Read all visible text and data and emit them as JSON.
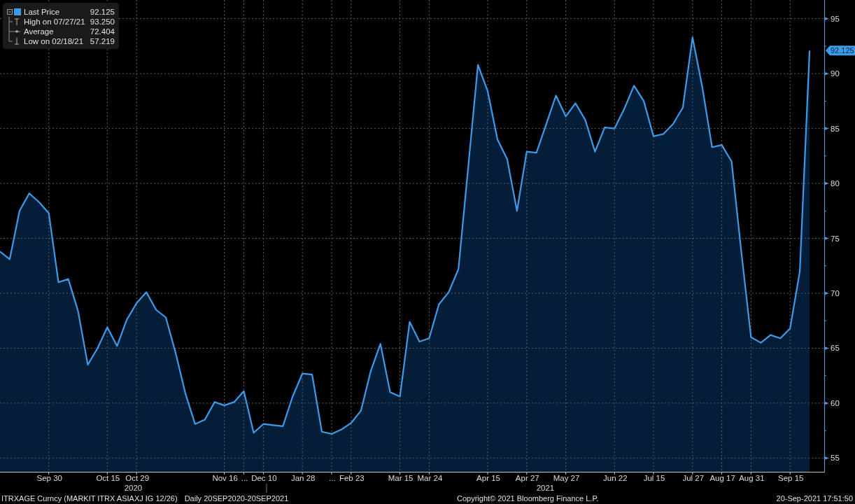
{
  "legend": {
    "expanded": true,
    "items": [
      {
        "kind": "series",
        "value": "92.125"
      },
      {
        "kind": "high",
        "label": "High on 07/27/21",
        "value": "93.250"
      },
      {
        "kind": "average",
        "label": "Average",
        "value": "72.404"
      },
      {
        "kind": "low",
        "label": "Low on 02/18/21",
        "value": "57.219"
      }
    ]
  },
  "chart": {
    "price_tag": "92.125",
    "chart_data": {
      "type": "area",
      "grid": true,
      "categories": [
        null,
        null,
        null,
        null,
        null,
        "Sep 30",
        null,
        null,
        null,
        null,
        null,
        "Oct 15",
        null,
        null,
        "Oct 29",
        null,
        null,
        null,
        null,
        null,
        null,
        null,
        null,
        "Nov 16",
        null,
        "...",
        null,
        "Dec 10",
        null,
        null,
        null,
        "Jan 28",
        null,
        null,
        "...",
        null,
        "Feb 23",
        null,
        null,
        null,
        null,
        "Mar 15",
        null,
        null,
        "Mar 24",
        null,
        null,
        null,
        null,
        null,
        "Apr 15",
        null,
        null,
        null,
        "Apr 27",
        null,
        null,
        null,
        "May 27",
        null,
        null,
        null,
        null,
        "Jun 22",
        null,
        null,
        null,
        "Jul 15",
        null,
        null,
        null,
        "Jul 27",
        null,
        null,
        "Aug 17",
        null,
        null,
        "Aug 31",
        null,
        null,
        null,
        "Sep 15",
        null,
        null
      ],
      "series": [
        {
          "name": "Last Price",
          "color": "#3d9be9",
          "values": [
            73.8,
            73.1,
            77.5,
            79.1,
            78.3,
            77.3,
            71.0,
            71.3,
            68.4,
            63.5,
            65.0,
            66.9,
            65.2,
            67.6,
            69.1,
            70.1,
            68.5,
            67.8,
            64.6,
            60.9,
            58.1,
            58.5,
            60.1,
            59.8,
            60.1,
            61.1,
            57.3,
            58.1,
            58.0,
            57.9,
            60.6,
            62.7,
            62.6,
            57.4,
            57.2,
            57.6,
            58.2,
            59.3,
            62.9,
            65.4,
            61.0,
            60.6,
            67.4,
            65.6,
            65.9,
            69.0,
            70.1,
            72.2,
            81.5,
            90.8,
            88.4,
            84.0,
            82.2,
            77.5,
            82.9,
            82.8,
            85.4,
            88.0,
            86.1,
            87.3,
            85.8,
            82.9,
            85.1,
            85.0,
            86.8,
            88.9,
            87.5,
            84.3,
            84.5,
            85.4,
            86.9,
            93.3,
            88.8,
            83.3,
            83.5,
            82.0,
            73.8,
            66.0,
            65.5,
            66.2,
            65.9,
            66.8,
            72.0,
            92.1
          ]
        }
      ],
      "ylim": [
        53.75,
        96.7
      ],
      "yticks": [
        55,
        60,
        65,
        70,
        75,
        80,
        85,
        90,
        95
      ],
      "annotations": [
        "2020",
        "2021"
      ]
    }
  },
  "status_bar": {
    "security": "ITRXAGE Curncy (MARKIT ITRX ASIAXJ IG 12/26)",
    "period": "Daily 20SEP2020-20SEP2021",
    "copyright": "Copyright© 2021 Bloomberg Finance L.P.",
    "timestamp": "20-Sep-2021 17:51:50"
  }
}
